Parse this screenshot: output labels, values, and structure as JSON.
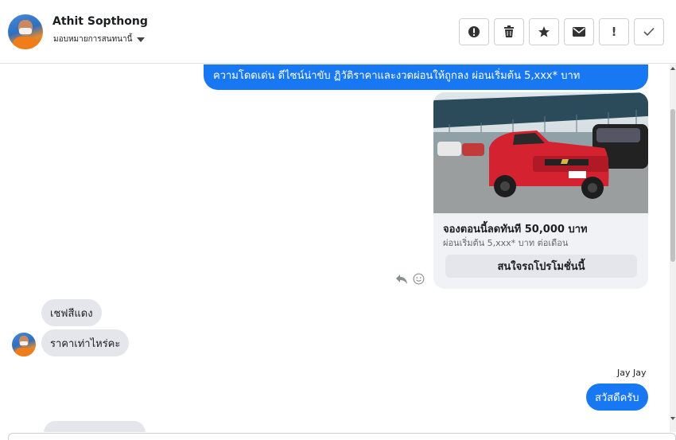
{
  "header": {
    "contact_name": "Athit Sopthong",
    "assign_label": "มอบหมายการสนทนานี้",
    "actions": [
      {
        "icon": "alert-circle-icon",
        "label": ""
      },
      {
        "icon": "trash-icon",
        "label": ""
      },
      {
        "icon": "star-icon",
        "label": ""
      },
      {
        "icon": "envelope-icon",
        "label": ""
      },
      {
        "icon": "exclamation-icon",
        "label": "!"
      },
      {
        "icon": "checkmark-icon",
        "label": ""
      }
    ]
  },
  "messages": {
    "outgoing_top_text": "ความโดดเด่น ดีไซน์น่าขับ ฏิวัติราคาและงวดผ่อนให้ถูกลง ผ่อนเริ่มต้น 5,xxx* บาท",
    "card": {
      "title": "จองตอนนี้ลดทันที 50,000 บาท",
      "subtitle": "ผ่อนเริ่มต้น 5,xxx* บาท ต่อเดือน",
      "button_label": "สนใจรถโปรโมชั่นนี้"
    },
    "incoming_1": "เชฟสีแดง",
    "incoming_2": "ราคาเท่าไหร่คะ",
    "sender_name": "Jay Jay",
    "outgoing_reply": "สวัสดีครับ"
  },
  "colors": {
    "accent": "#1877f2",
    "bubble_in": "#e4e6eb",
    "card_bg": "#f0f2f5"
  }
}
